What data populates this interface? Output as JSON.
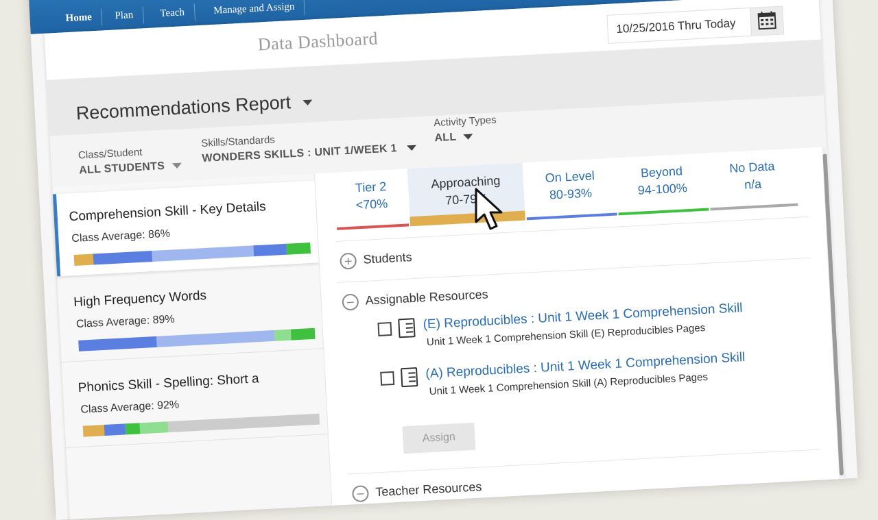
{
  "nav": {
    "tabs": [
      {
        "label": "Home"
      },
      {
        "label": "Plan"
      },
      {
        "label": "Teach"
      },
      {
        "label": "Manage and Assign"
      }
    ]
  },
  "header": {
    "title": "Data Dashboard",
    "date_range": "10/25/2016 Thru Today",
    "calendar_icon": "calendar-icon"
  },
  "report": {
    "title": "Recommendations Report"
  },
  "filters": {
    "class_label": "Class/Student",
    "class_value": "ALL STUDENTS",
    "skills_label": "Skills/Standards",
    "skills_value": "WONDERS SKILLS : UNIT 1/WEEK 1",
    "activity_label": "Activity Types",
    "activity_value": "ALL"
  },
  "skills": [
    {
      "name": "Comprehension Skill - Key Details",
      "avg": "Class Average: 86%",
      "segments": [
        {
          "color": "#e0ad4f",
          "frac": 0.08
        },
        {
          "color": "#5b7fe0",
          "frac": 0.25
        },
        {
          "color": "#9fb7ee",
          "frac": 0.43
        },
        {
          "color": "#5b7fe0",
          "frac": 0.14
        },
        {
          "color": "#3fc13f",
          "frac": 0.1
        }
      ]
    },
    {
      "name": "High Frequency Words",
      "avg": "Class Average: 89%",
      "segments": [
        {
          "color": "#5b7fe0",
          "frac": 0.33
        },
        {
          "color": "#9fb7ee",
          "frac": 0.5
        },
        {
          "color": "#8fde8f",
          "frac": 0.07
        },
        {
          "color": "#3fc13f",
          "frac": 0.1
        }
      ]
    },
    {
      "name": "Phonics Skill - Spelling: Short a",
      "avg": "Class Average: 92%",
      "segments": [
        {
          "color": "#e0ad4f",
          "frac": 0.09
        },
        {
          "color": "#5b7fe0",
          "frac": 0.09
        },
        {
          "color": "#3fc13f",
          "frac": 0.06
        },
        {
          "color": "#8fde8f",
          "frac": 0.12
        },
        {
          "color": "#cccccc",
          "frac": 0.64
        }
      ]
    }
  ],
  "tiers": [
    {
      "name": "Tier 2",
      "range": "<70%",
      "color": "#d9534f"
    },
    {
      "name": "Approaching",
      "range": "70-79%",
      "color": "#e0ad4f"
    },
    {
      "name": "On Level",
      "range": "80-93%",
      "color": "#5b7fe0"
    },
    {
      "name": "Beyond",
      "range": "94-100%",
      "color": "#3fc13f"
    },
    {
      "name": "No Data",
      "range": "n/a",
      "color": "#aaaaaa"
    }
  ],
  "sections": {
    "students": "Students",
    "assignable": "Assignable Resources",
    "teacher": "Teacher Resources"
  },
  "resources": [
    {
      "title": "(E) Reproducibles : Unit 1 Week 1 Comprehension Skill",
      "subtitle": "Unit 1 Week 1 Comprehension Skill (E) Reproducibles Pages"
    },
    {
      "title": "(A) Reproducibles : Unit 1 Week 1 Comprehension Skill",
      "subtitle": "Unit 1 Week 1 Comprehension Skill (A) Reproducibles Pages"
    }
  ],
  "assign_label": "Assign",
  "colors": {
    "nav_blue": "#2a72b5",
    "link_blue": "#2a6db3"
  }
}
